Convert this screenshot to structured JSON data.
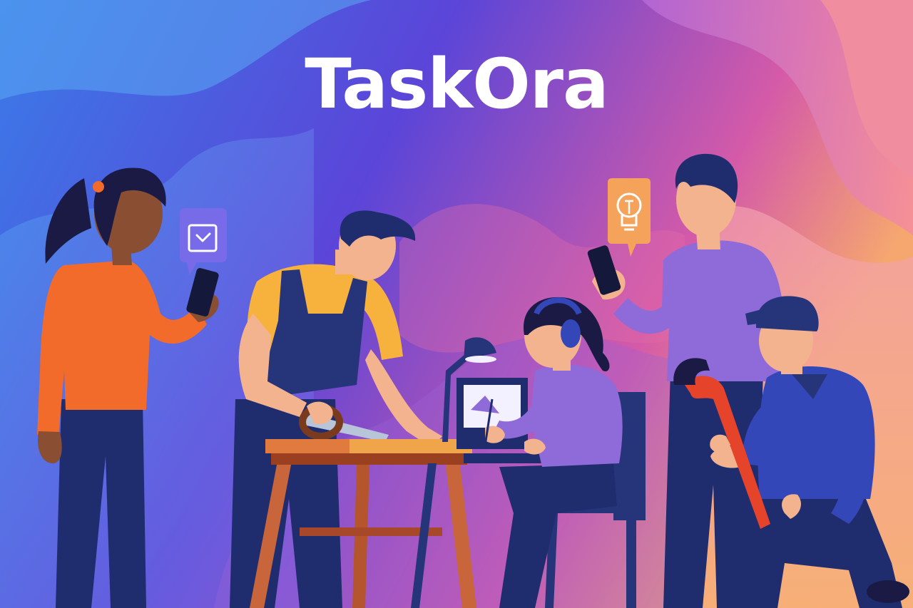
{
  "brand": {
    "title": "TaskOra"
  },
  "scene": {
    "icons": [
      "inbox-check-icon",
      "lightbulb-icon"
    ],
    "colors": {
      "bg_left": "#3a7be8",
      "bg_center": "#5b45d8",
      "bg_right": "#f07a9a",
      "bg_warm": "#f6a76f",
      "navy": "#1f2d6e",
      "skin": "#f3b38f",
      "skin_dark": "#8a4f33",
      "orange": "#f26b2a",
      "yellow": "#f6b23c",
      "purple": "#8f6ad9",
      "wood": "#c9653a",
      "wrench": "#e5432a"
    }
  }
}
